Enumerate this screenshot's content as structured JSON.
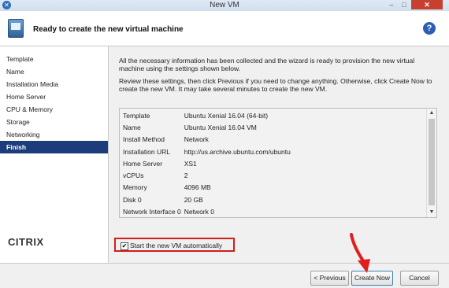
{
  "window": {
    "title": "New VM",
    "minimize": "–",
    "maximize": "□",
    "close": "✕"
  },
  "header": {
    "title": "Ready to create the new virtual machine",
    "help": "?"
  },
  "nav": {
    "items": [
      {
        "label": "Template"
      },
      {
        "label": "Name"
      },
      {
        "label": "Installation Media"
      },
      {
        "label": "Home Server"
      },
      {
        "label": "CPU & Memory"
      },
      {
        "label": "Storage"
      },
      {
        "label": "Networking"
      },
      {
        "label": "Finish"
      }
    ],
    "active": "Finish"
  },
  "logo": "CITRIX",
  "main": {
    "intro1": "All the necessary information has been collected and the wizard is ready to provision the new virtual machine using the settings shown below.",
    "intro2": "Review these settings, then click Previous if you need to change anything. Otherwise, click Create Now to create the new VM. It may take several minutes to create the new VM.",
    "summary": [
      {
        "key": "Template",
        "value": "Ubuntu Xenial 16.04 (64-bit)"
      },
      {
        "key": "Name",
        "value": "Ubuntu Xenial 16.04 VM"
      },
      {
        "key": "Install Method",
        "value": "Network"
      },
      {
        "key": "Installation URL",
        "value": "http://us.archive.ubuntu.com/ubuntu"
      },
      {
        "key": "Home Server",
        "value": "XS1"
      },
      {
        "key": "vCPUs",
        "value": "2"
      },
      {
        "key": "Memory",
        "value": "4096 MB"
      },
      {
        "key": "Disk 0",
        "value": "20 GB"
      },
      {
        "key": "Network Interface 0",
        "value": "Network 0"
      }
    ],
    "start_checkbox": {
      "label": "Start the new VM automatically",
      "checked": true,
      "mark": "✔"
    }
  },
  "footer": {
    "previous": "< Previous",
    "create": "Create Now",
    "cancel": "Cancel"
  },
  "colors": {
    "accent": "#1c3c7c",
    "highlight": "#d41c1c"
  },
  "icons": {
    "scroll_up": "▲",
    "scroll_down": "▼"
  }
}
